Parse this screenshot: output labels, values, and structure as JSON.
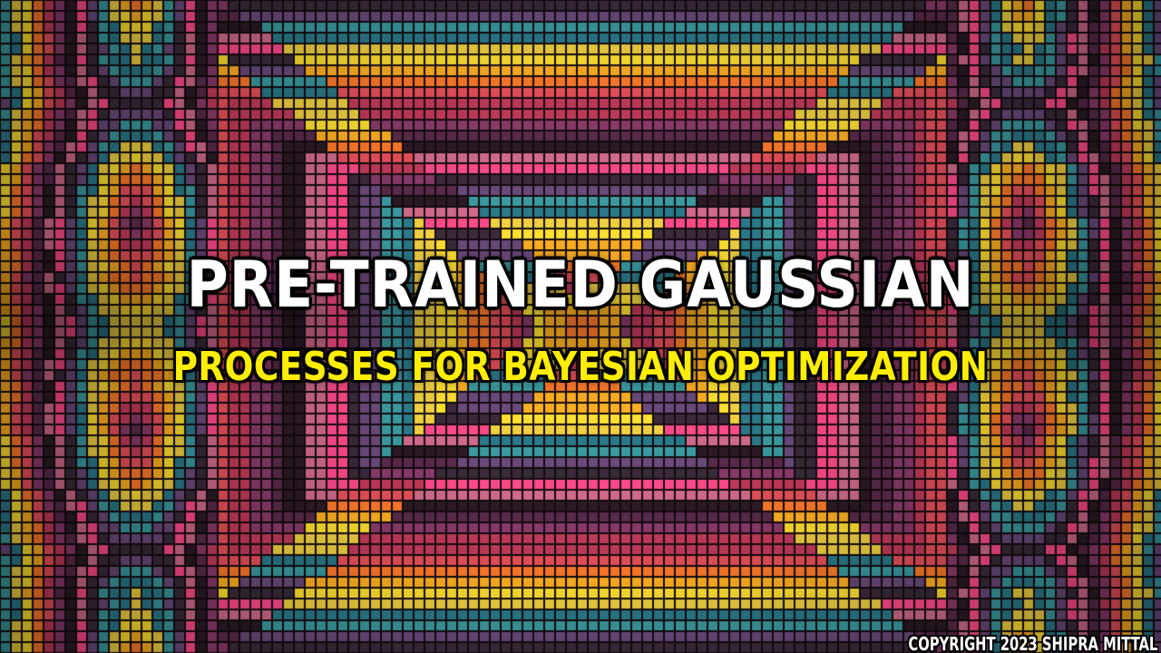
{
  "thumbnail": {
    "title": "PRE-TRAINED GAUSSIAN",
    "subtitle": "PROCESSES FOR BAYESIAN OPTIMIZATION",
    "copyright": "COPYRIGHT 2023 SHIPRA MITTAL"
  },
  "palette": {
    "title_color": "#ffffff",
    "subtitle_color": "#ffee00",
    "outline_color": "#000000",
    "background": [
      "#2b1a24",
      "#5a2a4a",
      "#8a3a6a",
      "#c23a5a",
      "#e8505a",
      "#ff7a2a",
      "#ffb020",
      "#ffe030",
      "#f0d040",
      "#2a7a8a",
      "#3a9aa0",
      "#6a4a7a",
      "#3a2a3a",
      "#ff4a8a",
      "#d06a8a"
    ]
  },
  "background_image": {
    "description_icon": "mosaic-tile-pattern"
  }
}
